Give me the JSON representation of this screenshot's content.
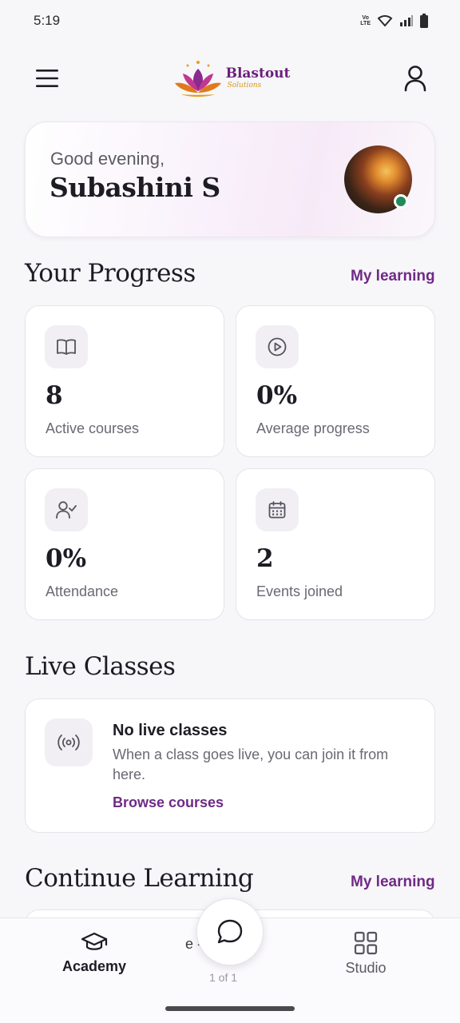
{
  "status_bar": {
    "time": "5:19",
    "network_badge": "Vo LTE"
  },
  "header": {
    "menu_icon": "hamburger-menu-icon",
    "brand_name": "Blastout",
    "brand_subtitle": "Solutions",
    "profile_icon": "user-icon"
  },
  "greeting": {
    "salutation": "Good evening,",
    "name": "Subashini S",
    "online": true
  },
  "progress": {
    "title": "Your Progress",
    "link": "My learning",
    "stats": [
      {
        "icon": "book-open-icon",
        "value": "8",
        "label": "Active courses"
      },
      {
        "icon": "play-circle-icon",
        "value": "0%",
        "label": "Average progress"
      },
      {
        "icon": "user-check-icon",
        "value": "0%",
        "label": "Attendance"
      },
      {
        "icon": "calendar-icon",
        "value": "2",
        "label": "Events joined"
      }
    ]
  },
  "live_classes": {
    "title": "Live Classes",
    "icon": "broadcast-icon",
    "empty_title": "No live classes",
    "empty_desc": "When a class goes live, you can join it from here.",
    "link": "Browse courses"
  },
  "continue_learning": {
    "title": "Continue Learning",
    "link": "My learning",
    "partial_title": "e - I",
    "partial_sub": "1 of 1"
  },
  "bottom_nav": {
    "items": [
      {
        "icon": "graduation-cap-icon",
        "label": "Academy",
        "active": true
      },
      {
        "icon": "grid-icon",
        "label": "Studio",
        "active": false
      }
    ],
    "fab_icon": "chat-bubble-icon"
  },
  "colors": {
    "accent": "#6f2a85",
    "online": "#1f8a5a",
    "background": "#f7f6f9"
  }
}
